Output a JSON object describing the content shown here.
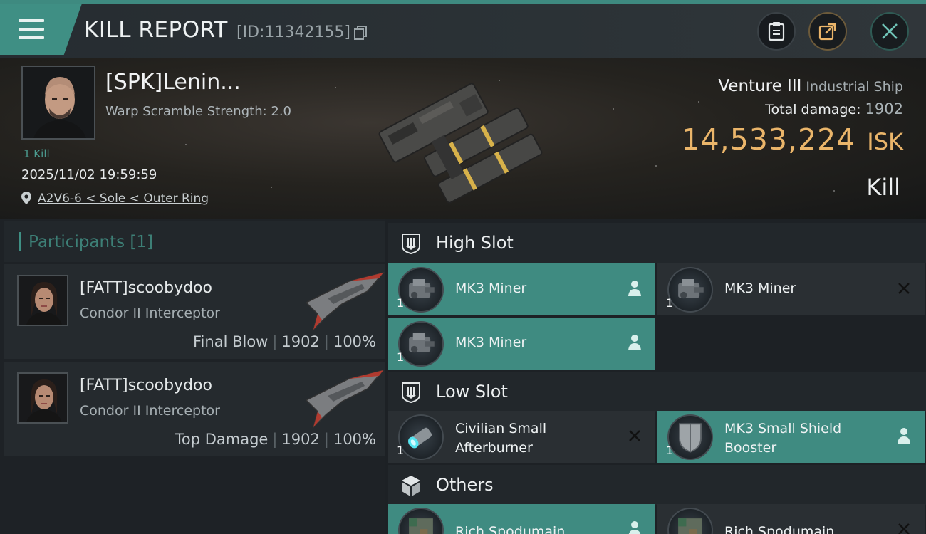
{
  "header": {
    "title": "KILL REPORT",
    "report_id": "[ID:11342155]"
  },
  "victim": {
    "pilot_name": "[SPK]Lenin...",
    "warp_scramble": "Warp Scramble Strength: 2.0",
    "kill_count": "1 Kill",
    "datetime": "2025/11/02 19:59:59",
    "location": "A2V6-6 < Sole < Outer Ring",
    "ship_name": "Venture III",
    "ship_class": "Industrial Ship",
    "total_damage_label": "Total damage:",
    "total_damage_value": "1902",
    "isk_value": "14,533,224",
    "isk_unit": "ISK",
    "result": "Kill"
  },
  "participants": {
    "title": "Participants",
    "count": "[1]",
    "list": [
      {
        "name": "[FATT]scoobydoo",
        "ship": "Condor II Interceptor",
        "role": "Final Blow",
        "damage": "1902",
        "percent": "100%"
      },
      {
        "name": "[FATT]scoobydoo",
        "ship": "Condor II Interceptor",
        "role": "Top Damage",
        "damage": "1902",
        "percent": "100%"
      }
    ]
  },
  "slots": {
    "high": {
      "title": "High Slot",
      "modules": [
        {
          "name": "MK3 Miner",
          "qty": "1",
          "status": "dropped"
        },
        {
          "name": "MK3 Miner",
          "qty": "1",
          "status": "destroyed"
        },
        {
          "name": "MK3 Miner",
          "qty": "1",
          "status": "dropped"
        }
      ]
    },
    "low": {
      "title": "Low Slot",
      "modules": [
        {
          "name_line1": "Civilian Small",
          "name_line2": "Afterburner",
          "qty": "1",
          "status": "destroyed"
        },
        {
          "name_line1": "MK3 Small Shield",
          "name_line2": "Booster",
          "qty": "1",
          "status": "dropped"
        }
      ]
    },
    "others": {
      "title": "Others",
      "modules": [
        {
          "name": "Rich Spodumain",
          "qty": "",
          "status": "dropped"
        },
        {
          "name": "Rich Spodumain",
          "qty": "",
          "status": "destroyed"
        }
      ]
    }
  },
  "colors": {
    "accent": "#3f8f84",
    "isk": "#eab56a",
    "background": "#1b1f23"
  },
  "icons": {
    "menu": "hamburger-menu-icon",
    "copy": "copy-icon",
    "clipboard": "clipboard-icon",
    "share": "share-icon",
    "close": "close-icon",
    "location": "location-pin-icon",
    "dropped": "person-icon",
    "destroyed": "x-mark-icon"
  }
}
